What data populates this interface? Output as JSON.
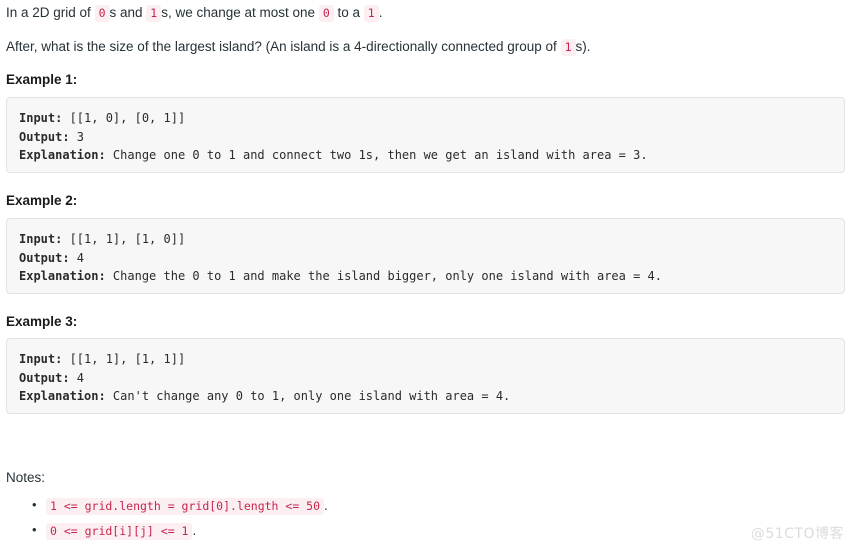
{
  "intro": {
    "line1_a": "In a 2D grid of ",
    "line1_code1": "0",
    "line1_b": "s and ",
    "line1_code2": "1",
    "line1_c": "s, we change at most one ",
    "line1_code3": "0",
    "line1_d": " to a ",
    "line1_code4": "1",
    "line1_e": ".",
    "line2_a": "After, what is the size of the largest island? (An island is a 4-directionally connected group of ",
    "line2_code1": "1",
    "line2_b": "s)."
  },
  "examples": [
    {
      "title": "Example 1:",
      "input_label": "Input:",
      "input_value": " [[1, 0], [0, 1]]",
      "output_label": "Output:",
      "output_value": " 3",
      "explanation_label": "Explanation:",
      "explanation_value": " Change one 0 to 1 and connect two 1s, then we get an island with area = 3."
    },
    {
      "title": "Example 2:",
      "input_label": "Input:",
      "input_value": " [[1, 1], [1, 0]]",
      "output_label": "Output:",
      "output_value": " 4",
      "explanation_label": "Explanation:",
      "explanation_value": " Change the 0 to 1 and make the island bigger, only one island with area = 4."
    },
    {
      "title": "Example 3:",
      "input_label": "Input:",
      "input_value": " [[1, 1], [1, 1]]",
      "output_label": "Output:",
      "output_value": " 4",
      "explanation_label": "Explanation:",
      "explanation_value": " Can't change any 0 to 1, only one island with area = 4."
    }
  ],
  "notes": {
    "label": "Notes:",
    "items": [
      {
        "code": "1 <= grid.length = grid[0].length <= 50",
        "suffix": "."
      },
      {
        "code": "0 <= grid[i][j] <= 1",
        "suffix": "."
      }
    ]
  },
  "watermark": {
    "text": "@51CTO博客"
  },
  "colors": {
    "inline_code_text": "#c7254e",
    "inline_code_bg": "#fbeff2",
    "code_block_bg": "#f7f7f7",
    "code_block_border": "#e3e3e3",
    "body_text": "#263238",
    "watermark": "#dcdcdc"
  }
}
